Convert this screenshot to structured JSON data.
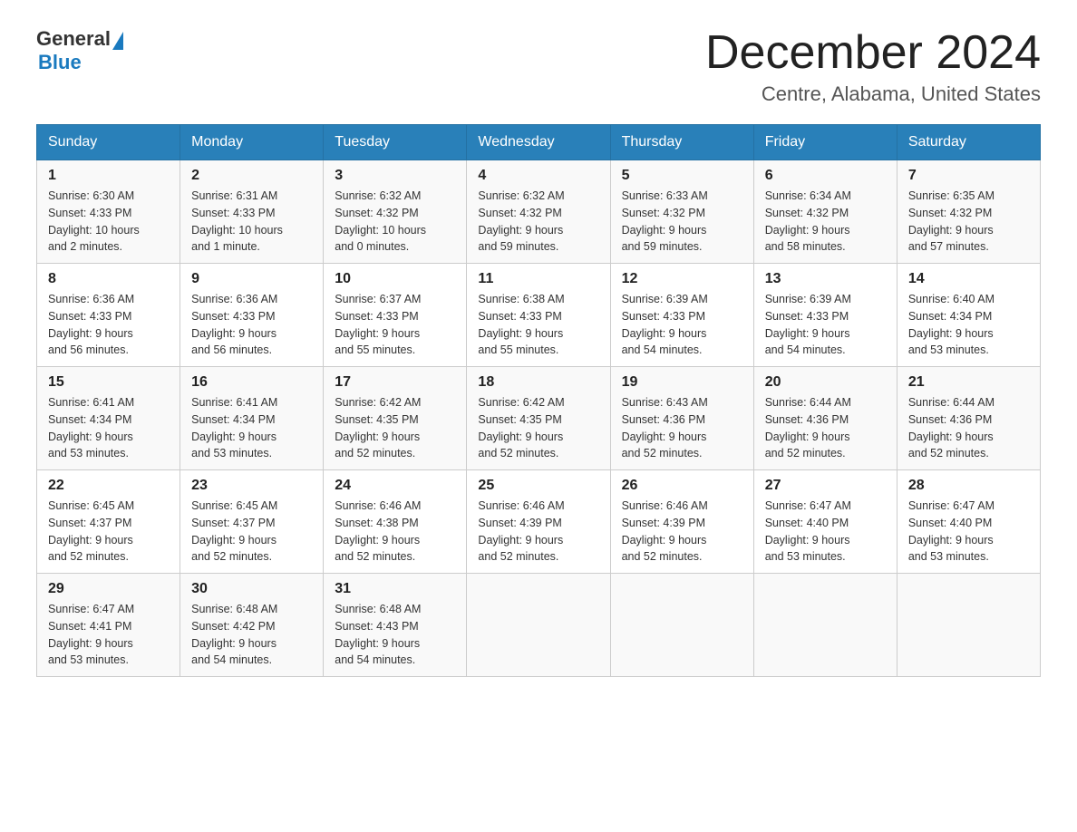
{
  "header": {
    "logo": {
      "text_general": "General",
      "text_blue": "Blue"
    },
    "month_title": "December 2024",
    "location": "Centre, Alabama, United States"
  },
  "weekdays": [
    "Sunday",
    "Monday",
    "Tuesday",
    "Wednesday",
    "Thursday",
    "Friday",
    "Saturday"
  ],
  "weeks": [
    [
      {
        "day": "1",
        "sunrise": "6:30 AM",
        "sunset": "4:33 PM",
        "daylight": "10 hours and 2 minutes."
      },
      {
        "day": "2",
        "sunrise": "6:31 AM",
        "sunset": "4:33 PM",
        "daylight": "10 hours and 1 minute."
      },
      {
        "day": "3",
        "sunrise": "6:32 AM",
        "sunset": "4:32 PM",
        "daylight": "10 hours and 0 minutes."
      },
      {
        "day": "4",
        "sunrise": "6:32 AM",
        "sunset": "4:32 PM",
        "daylight": "9 hours and 59 minutes."
      },
      {
        "day": "5",
        "sunrise": "6:33 AM",
        "sunset": "4:32 PM",
        "daylight": "9 hours and 59 minutes."
      },
      {
        "day": "6",
        "sunrise": "6:34 AM",
        "sunset": "4:32 PM",
        "daylight": "9 hours and 58 minutes."
      },
      {
        "day": "7",
        "sunrise": "6:35 AM",
        "sunset": "4:32 PM",
        "daylight": "9 hours and 57 minutes."
      }
    ],
    [
      {
        "day": "8",
        "sunrise": "6:36 AM",
        "sunset": "4:33 PM",
        "daylight": "9 hours and 56 minutes."
      },
      {
        "day": "9",
        "sunrise": "6:36 AM",
        "sunset": "4:33 PM",
        "daylight": "9 hours and 56 minutes."
      },
      {
        "day": "10",
        "sunrise": "6:37 AM",
        "sunset": "4:33 PM",
        "daylight": "9 hours and 55 minutes."
      },
      {
        "day": "11",
        "sunrise": "6:38 AM",
        "sunset": "4:33 PM",
        "daylight": "9 hours and 55 minutes."
      },
      {
        "day": "12",
        "sunrise": "6:39 AM",
        "sunset": "4:33 PM",
        "daylight": "9 hours and 54 minutes."
      },
      {
        "day": "13",
        "sunrise": "6:39 AM",
        "sunset": "4:33 PM",
        "daylight": "9 hours and 54 minutes."
      },
      {
        "day": "14",
        "sunrise": "6:40 AM",
        "sunset": "4:34 PM",
        "daylight": "9 hours and 53 minutes."
      }
    ],
    [
      {
        "day": "15",
        "sunrise": "6:41 AM",
        "sunset": "4:34 PM",
        "daylight": "9 hours and 53 minutes."
      },
      {
        "day": "16",
        "sunrise": "6:41 AM",
        "sunset": "4:34 PM",
        "daylight": "9 hours and 53 minutes."
      },
      {
        "day": "17",
        "sunrise": "6:42 AM",
        "sunset": "4:35 PM",
        "daylight": "9 hours and 52 minutes."
      },
      {
        "day": "18",
        "sunrise": "6:42 AM",
        "sunset": "4:35 PM",
        "daylight": "9 hours and 52 minutes."
      },
      {
        "day": "19",
        "sunrise": "6:43 AM",
        "sunset": "4:36 PM",
        "daylight": "9 hours and 52 minutes."
      },
      {
        "day": "20",
        "sunrise": "6:44 AM",
        "sunset": "4:36 PM",
        "daylight": "9 hours and 52 minutes."
      },
      {
        "day": "21",
        "sunrise": "6:44 AM",
        "sunset": "4:36 PM",
        "daylight": "9 hours and 52 minutes."
      }
    ],
    [
      {
        "day": "22",
        "sunrise": "6:45 AM",
        "sunset": "4:37 PM",
        "daylight": "9 hours and 52 minutes."
      },
      {
        "day": "23",
        "sunrise": "6:45 AM",
        "sunset": "4:37 PM",
        "daylight": "9 hours and 52 minutes."
      },
      {
        "day": "24",
        "sunrise": "6:46 AM",
        "sunset": "4:38 PM",
        "daylight": "9 hours and 52 minutes."
      },
      {
        "day": "25",
        "sunrise": "6:46 AM",
        "sunset": "4:39 PM",
        "daylight": "9 hours and 52 minutes."
      },
      {
        "day": "26",
        "sunrise": "6:46 AM",
        "sunset": "4:39 PM",
        "daylight": "9 hours and 52 minutes."
      },
      {
        "day": "27",
        "sunrise": "6:47 AM",
        "sunset": "4:40 PM",
        "daylight": "9 hours and 53 minutes."
      },
      {
        "day": "28",
        "sunrise": "6:47 AM",
        "sunset": "4:40 PM",
        "daylight": "9 hours and 53 minutes."
      }
    ],
    [
      {
        "day": "29",
        "sunrise": "6:47 AM",
        "sunset": "4:41 PM",
        "daylight": "9 hours and 53 minutes."
      },
      {
        "day": "30",
        "sunrise": "6:48 AM",
        "sunset": "4:42 PM",
        "daylight": "9 hours and 54 minutes."
      },
      {
        "day": "31",
        "sunrise": "6:48 AM",
        "sunset": "4:43 PM",
        "daylight": "9 hours and 54 minutes."
      },
      null,
      null,
      null,
      null
    ]
  ],
  "labels": {
    "sunrise": "Sunrise:",
    "sunset": "Sunset:",
    "daylight": "Daylight:"
  }
}
